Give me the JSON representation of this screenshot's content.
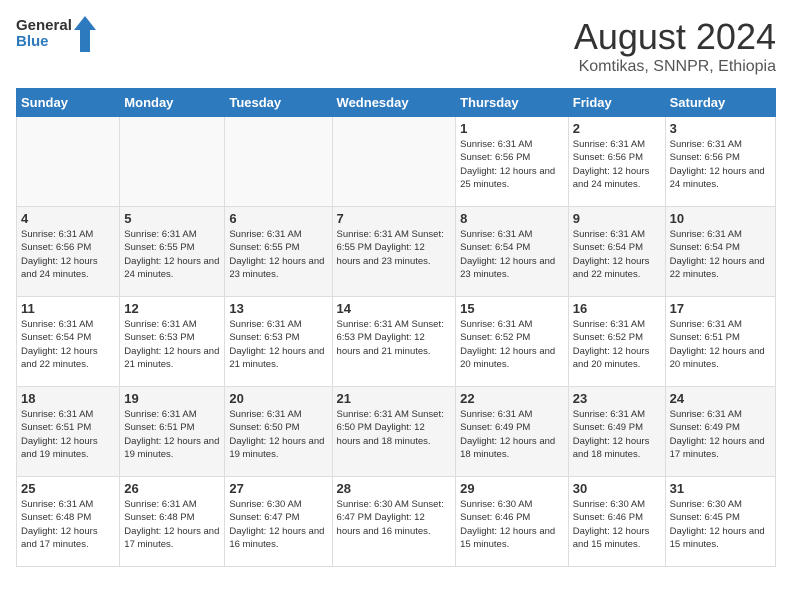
{
  "logo": {
    "text_general": "General",
    "text_blue": "Blue"
  },
  "title": "August 2024",
  "subtitle": "Komtikas, SNNPR, Ethiopia",
  "days_of_week": [
    "Sunday",
    "Monday",
    "Tuesday",
    "Wednesday",
    "Thursday",
    "Friday",
    "Saturday"
  ],
  "weeks": [
    [
      {
        "day": "",
        "info": ""
      },
      {
        "day": "",
        "info": ""
      },
      {
        "day": "",
        "info": ""
      },
      {
        "day": "",
        "info": ""
      },
      {
        "day": "1",
        "info": "Sunrise: 6:31 AM\nSunset: 6:56 PM\nDaylight: 12 hours\nand 25 minutes."
      },
      {
        "day": "2",
        "info": "Sunrise: 6:31 AM\nSunset: 6:56 PM\nDaylight: 12 hours\nand 24 minutes."
      },
      {
        "day": "3",
        "info": "Sunrise: 6:31 AM\nSunset: 6:56 PM\nDaylight: 12 hours\nand 24 minutes."
      }
    ],
    [
      {
        "day": "4",
        "info": "Sunrise: 6:31 AM\nSunset: 6:56 PM\nDaylight: 12 hours\nand 24 minutes."
      },
      {
        "day": "5",
        "info": "Sunrise: 6:31 AM\nSunset: 6:55 PM\nDaylight: 12 hours\nand 24 minutes."
      },
      {
        "day": "6",
        "info": "Sunrise: 6:31 AM\nSunset: 6:55 PM\nDaylight: 12 hours\nand 23 minutes."
      },
      {
        "day": "7",
        "info": "Sunrise: 6:31 AM\nSunset: 6:55 PM\nDaylight: 12 hours\nand 23 minutes."
      },
      {
        "day": "8",
        "info": "Sunrise: 6:31 AM\nSunset: 6:54 PM\nDaylight: 12 hours\nand 23 minutes."
      },
      {
        "day": "9",
        "info": "Sunrise: 6:31 AM\nSunset: 6:54 PM\nDaylight: 12 hours\nand 22 minutes."
      },
      {
        "day": "10",
        "info": "Sunrise: 6:31 AM\nSunset: 6:54 PM\nDaylight: 12 hours\nand 22 minutes."
      }
    ],
    [
      {
        "day": "11",
        "info": "Sunrise: 6:31 AM\nSunset: 6:54 PM\nDaylight: 12 hours\nand 22 minutes."
      },
      {
        "day": "12",
        "info": "Sunrise: 6:31 AM\nSunset: 6:53 PM\nDaylight: 12 hours\nand 21 minutes."
      },
      {
        "day": "13",
        "info": "Sunrise: 6:31 AM\nSunset: 6:53 PM\nDaylight: 12 hours\nand 21 minutes."
      },
      {
        "day": "14",
        "info": "Sunrise: 6:31 AM\nSunset: 6:53 PM\nDaylight: 12 hours\nand 21 minutes."
      },
      {
        "day": "15",
        "info": "Sunrise: 6:31 AM\nSunset: 6:52 PM\nDaylight: 12 hours\nand 20 minutes."
      },
      {
        "day": "16",
        "info": "Sunrise: 6:31 AM\nSunset: 6:52 PM\nDaylight: 12 hours\nand 20 minutes."
      },
      {
        "day": "17",
        "info": "Sunrise: 6:31 AM\nSunset: 6:51 PM\nDaylight: 12 hours\nand 20 minutes."
      }
    ],
    [
      {
        "day": "18",
        "info": "Sunrise: 6:31 AM\nSunset: 6:51 PM\nDaylight: 12 hours\nand 19 minutes."
      },
      {
        "day": "19",
        "info": "Sunrise: 6:31 AM\nSunset: 6:51 PM\nDaylight: 12 hours\nand 19 minutes."
      },
      {
        "day": "20",
        "info": "Sunrise: 6:31 AM\nSunset: 6:50 PM\nDaylight: 12 hours\nand 19 minutes."
      },
      {
        "day": "21",
        "info": "Sunrise: 6:31 AM\nSunset: 6:50 PM\nDaylight: 12 hours\nand 18 minutes."
      },
      {
        "day": "22",
        "info": "Sunrise: 6:31 AM\nSunset: 6:49 PM\nDaylight: 12 hours\nand 18 minutes."
      },
      {
        "day": "23",
        "info": "Sunrise: 6:31 AM\nSunset: 6:49 PM\nDaylight: 12 hours\nand 18 minutes."
      },
      {
        "day": "24",
        "info": "Sunrise: 6:31 AM\nSunset: 6:49 PM\nDaylight: 12 hours\nand 17 minutes."
      }
    ],
    [
      {
        "day": "25",
        "info": "Sunrise: 6:31 AM\nSunset: 6:48 PM\nDaylight: 12 hours\nand 17 minutes."
      },
      {
        "day": "26",
        "info": "Sunrise: 6:31 AM\nSunset: 6:48 PM\nDaylight: 12 hours\nand 17 minutes."
      },
      {
        "day": "27",
        "info": "Sunrise: 6:30 AM\nSunset: 6:47 PM\nDaylight: 12 hours\nand 16 minutes."
      },
      {
        "day": "28",
        "info": "Sunrise: 6:30 AM\nSunset: 6:47 PM\nDaylight: 12 hours\nand 16 minutes."
      },
      {
        "day": "29",
        "info": "Sunrise: 6:30 AM\nSunset: 6:46 PM\nDaylight: 12 hours\nand 15 minutes."
      },
      {
        "day": "30",
        "info": "Sunrise: 6:30 AM\nSunset: 6:46 PM\nDaylight: 12 hours\nand 15 minutes."
      },
      {
        "day": "31",
        "info": "Sunrise: 6:30 AM\nSunset: 6:45 PM\nDaylight: 12 hours\nand 15 minutes."
      }
    ]
  ]
}
